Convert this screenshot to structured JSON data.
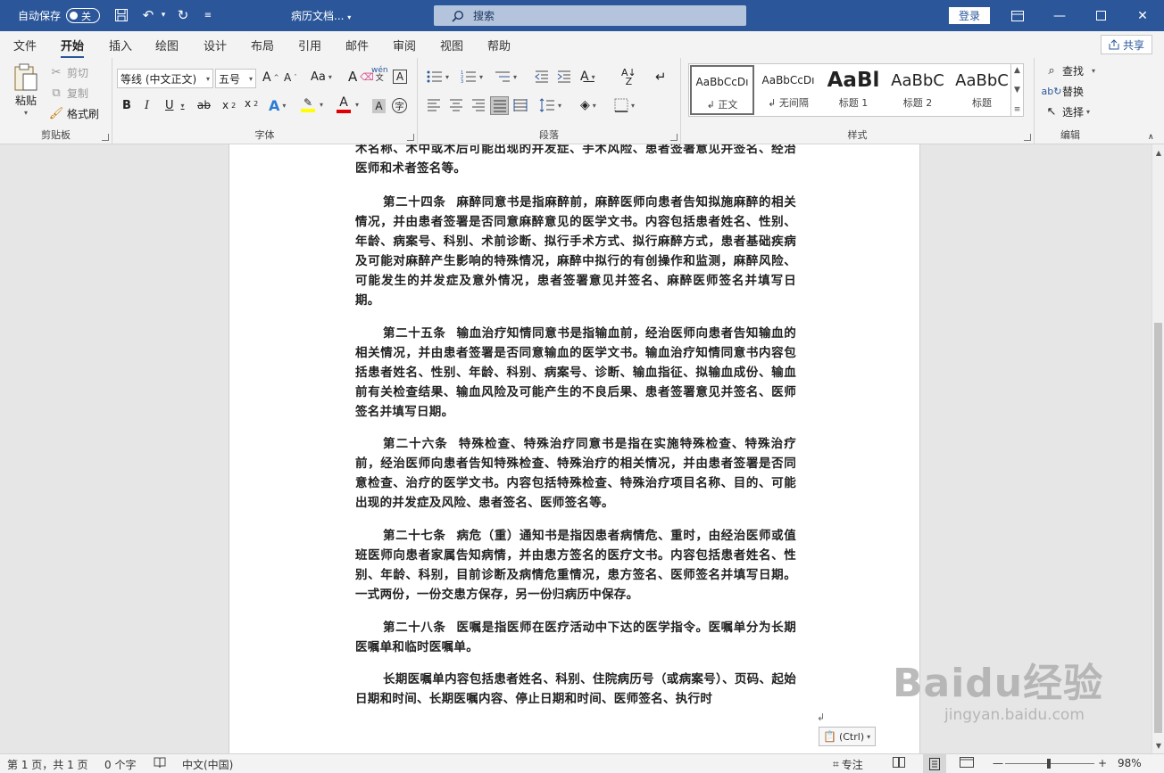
{
  "titlebar": {
    "autosave_label": "自动保存",
    "autosave_state": "关",
    "doc_title": "病历文档...",
    "search_placeholder": "搜索",
    "login_label": "登录"
  },
  "tabs": [
    "文件",
    "开始",
    "插入",
    "绘图",
    "设计",
    "布局",
    "引用",
    "邮件",
    "审阅",
    "视图",
    "帮助"
  ],
  "active_tab": "开始",
  "share_label": "共享",
  "clipboard": {
    "paste": "粘贴",
    "cut": "剪切",
    "copy": "复制",
    "format_painter": "格式刷",
    "group_label": "剪贴板"
  },
  "font": {
    "font_name": "等线 (中文正文)",
    "font_size": "五号",
    "group_label": "字体"
  },
  "paragraph": {
    "group_label": "段落"
  },
  "styles": {
    "items": [
      {
        "preview": "AaBbCcDı",
        "name": "↲ 正文"
      },
      {
        "preview": "AaBbCcDı",
        "name": "↲ 无间隔"
      },
      {
        "preview": "AaBl",
        "name": "标题 1"
      },
      {
        "preview": "AaBbC",
        "name": "标题 2"
      },
      {
        "preview": "AaBbC",
        "name": "标题"
      }
    ],
    "group_label": "样式"
  },
  "editing": {
    "find": "查找",
    "replace": "替换",
    "select": "选择",
    "group_label": "编辑"
  },
  "document": {
    "paragraphs": [
      {
        "head": "",
        "text": "术名称、术中或术后可能出现的并发症、手术风险、患者签署意见并签名、经治医师和术者签名等。"
      },
      {
        "head": "第二十四条",
        "text": "麻醉同意书是指麻醉前，麻醉医师向患者告知拟施麻醉的相关情况，并由患者签署是否同意麻醉意见的医学文书。内容包括患者姓名、性别、年龄、病案号、科别、术前诊断、拟行手术方式、拟行麻醉方式，患者基础疾病及可能对麻醉产生影响的特殊情况，麻醉中拟行的有创操作和监测，麻醉风险、可能发生的并发症及意外情况，患者签署意见并签名、麻醉医师签名并填写日期。"
      },
      {
        "head": "第二十五条",
        "text": "输血治疗知情同意书是指输血前，经治医师向患者告知输血的相关情况，并由患者签署是否同意输血的医学文书。输血治疗知情同意书内容包括患者姓名、性别、年龄、科别、病案号、诊断、输血指征、拟输血成份、输血前有关检查结果、输血风险及可能产生的不良后果、患者签署意见并签名、医师签名并填写日期。"
      },
      {
        "head": "第二十六条",
        "text": "特殊检查、特殊治疗同意书是指在实施特殊检查、特殊治疗前，经治医师向患者告知特殊检查、特殊治疗的相关情况，并由患者签署是否同意检查、治疗的医学文书。内容包括特殊检查、特殊治疗项目名称、目的、可能出现的并发症及风险、患者签名、医师签名等。"
      },
      {
        "head": "第二十七条",
        "text": "病危（重）通知书是指因患者病情危、重时，由经治医师或值班医师向患者家属告知病情，并由患方签名的医疗文书。内容包括患者姓名、性别、年龄、科别，目前诊断及病情危重情况，患方签名、医师签名并填写日期。一式两份，一份交患方保存，另一份归病历中保存。"
      },
      {
        "head": "第二十八条",
        "text": "医嘱是指医师在医疗活动中下达的医学指令。医嘱单分为长期医嘱单和临时医嘱单。"
      },
      {
        "head": "",
        "text": "长期医嘱单内容包括患者姓名、科别、住院病历号（或病案号）、页码、起始日期和时间、长期医嘱内容、停止日期和时间、医师签名、执行时"
      }
    ],
    "paste_tag": "(Ctrl)"
  },
  "statusbar": {
    "page": "第 1 页，共 1 页",
    "words": "0 个字",
    "language": "中文(中国)",
    "focus": "专注",
    "zoom": "98%",
    "zoom_fraction": 0.49
  },
  "watermark": {
    "main": "Baidu经验",
    "sub": "jingyan.baidu.com"
  },
  "colors": {
    "titlebar": "#2b579a",
    "highlight": "#ffff00",
    "font_color": "#e00000"
  }
}
